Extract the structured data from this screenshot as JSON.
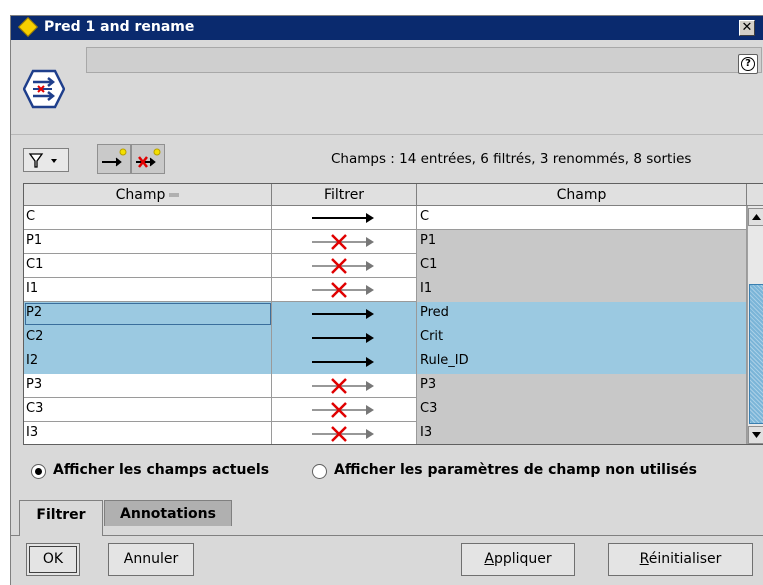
{
  "window": {
    "title": "Pred 1 and rename",
    "close_label": "✕"
  },
  "header": {
    "help_label": "?"
  },
  "toolbar": {
    "filter_label": "▽ ▾"
  },
  "summary": "Champs : 14 entrées, 6 filtrés, 3 renommés, 8 sorties",
  "table": {
    "headers": [
      "Champ",
      "Filtrer",
      "Champ"
    ],
    "rows": [
      {
        "in": "C",
        "filter": "pass",
        "out": "C"
      },
      {
        "in": "P1",
        "filter": "blocked",
        "out": "P1"
      },
      {
        "in": "C1",
        "filter": "blocked",
        "out": "C1"
      },
      {
        "in": "I1",
        "filter": "blocked",
        "out": "I1"
      },
      {
        "in": "P2",
        "filter": "pass",
        "out": "Pred"
      },
      {
        "in": "C2",
        "filter": "pass",
        "out": "Crit"
      },
      {
        "in": "I2",
        "filter": "pass",
        "out": "Rule_ID"
      },
      {
        "in": "P3",
        "filter": "blocked",
        "out": "P3"
      },
      {
        "in": "C3",
        "filter": "blocked",
        "out": "C3"
      },
      {
        "in": "I3",
        "filter": "blocked",
        "out": "I3"
      }
    ]
  },
  "options": {
    "show_current": "Afficher les champs actuels",
    "show_unused": "Afficher les paramètres de champ non utilisés",
    "selected": "show_current"
  },
  "tabs": [
    "Filtrer",
    "Annotations"
  ],
  "buttons": {
    "ok": "OK",
    "cancel": "Annuler",
    "apply_u": "A",
    "apply_rest": "ppliquer",
    "reset_u": "R",
    "reset_rest": "éinitialiser"
  },
  "colors": {
    "selection": "#9bc9e1",
    "titlebar": "#0a2a6e",
    "blocked_x": "#e00000"
  }
}
